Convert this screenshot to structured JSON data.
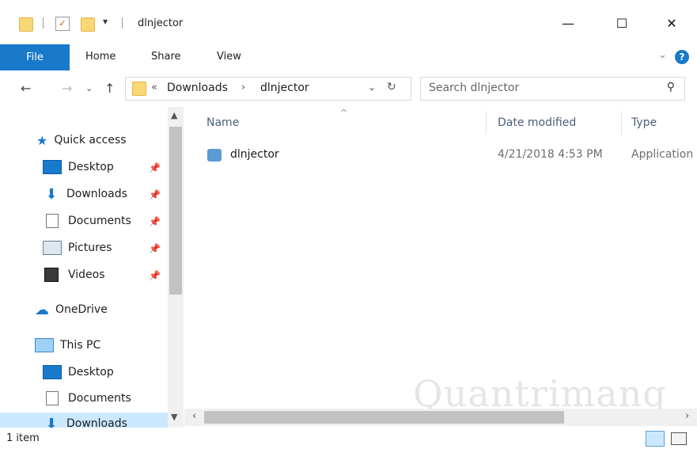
{
  "window": {
    "title": "dlnjector",
    "minimize_glyph": "—",
    "maximize_glyph": "☐",
    "close_glyph": "✕"
  },
  "ribbon": {
    "tabs": [
      "File",
      "Home",
      "Share",
      "View"
    ],
    "help_glyph": "?",
    "expand_glyph": "⌄"
  },
  "address": {
    "overflow": "«",
    "crumbs": [
      "Downloads",
      "dlnjector"
    ],
    "separator": "›",
    "search_placeholder": "Search dlnjector"
  },
  "nav": {
    "quick_access": "Quick access",
    "quick_items": [
      "Desktop",
      "Downloads",
      "Documents",
      "Pictures",
      "Videos"
    ],
    "onedrive": "OneDrive",
    "this_pc": "This PC",
    "pc_items": [
      "Desktop",
      "Documents",
      "Downloads"
    ]
  },
  "columns": {
    "name": "Name",
    "date": "Date modified",
    "type": "Type"
  },
  "files": [
    {
      "name": "dlnjector",
      "date": "4/21/2018 4:53 PM",
      "type": "Application"
    }
  ],
  "status": {
    "count": "1 item"
  },
  "watermark": "Quantrimang"
}
